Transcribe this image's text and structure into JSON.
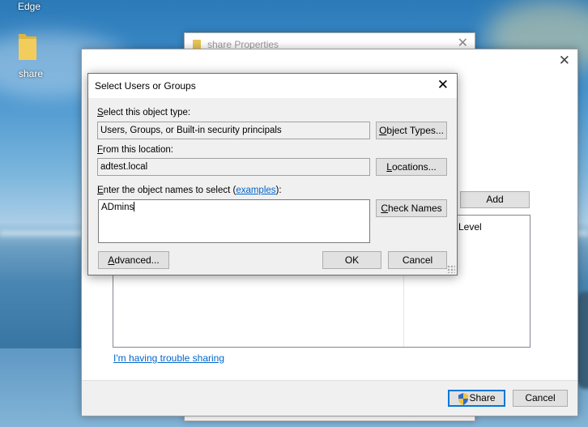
{
  "desktop": {
    "edge_label": "Edge",
    "folder_label": "share"
  },
  "share_properties": {
    "title": "share Properties",
    "close_glyph": "✕"
  },
  "file_sharing": {
    "close_glyph": "✕",
    "add_label": "Add",
    "permission_header": "Level",
    "trouble_link": "I'm having trouble sharing",
    "share_button": "Share",
    "cancel_button": "Cancel"
  },
  "select_dialog": {
    "title": "Select Users or Groups",
    "close_glyph": "✕",
    "object_type_label_prefix": "S",
    "object_type_label_rest": "elect this object type:",
    "object_type_value": "Users, Groups, or Built-in security principals",
    "object_types_button_u": "O",
    "object_types_button_rest": "bject Types...",
    "location_label_prefix": "F",
    "location_label_rest": "rom this location:",
    "location_value": "adtest.local",
    "locations_button_u": "L",
    "locations_button_rest": "ocations...",
    "names_label_prefix": "E",
    "names_label_rest": "nter the object names to select (",
    "names_label_link": "examples",
    "names_label_end": "):",
    "names_value": "ADmins",
    "check_names_button_u": "C",
    "check_names_button_rest": "heck Names",
    "advanced_button_u": "A",
    "advanced_button_rest": "dvanced...",
    "ok_button": "OK",
    "cancel_button": "Cancel"
  },
  "colors": {
    "accent": "#0078d7",
    "link": "#0066cc",
    "dialog_bg": "#f0f0f0"
  }
}
